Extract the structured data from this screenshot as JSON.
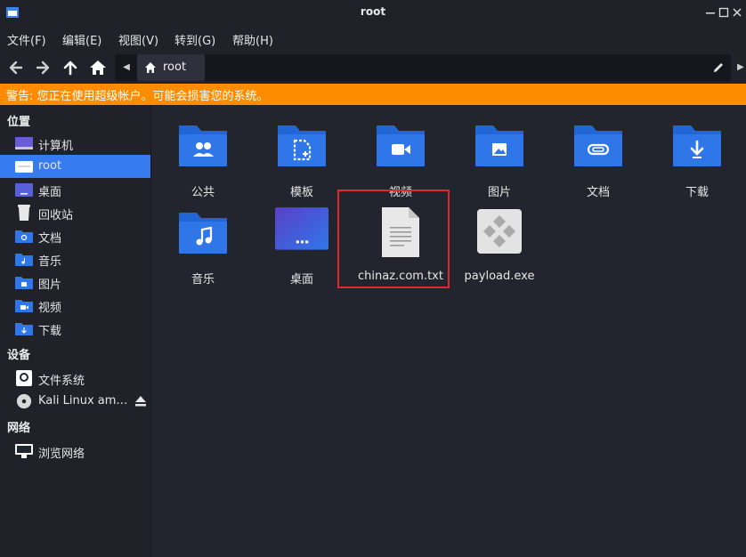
{
  "window": {
    "title": "root"
  },
  "menu": [
    "文件(F)",
    "编辑(E)",
    "视图(V)",
    "转到(G)",
    "帮助(H)"
  ],
  "pathbar": {
    "current": "root"
  },
  "warning": "警告: 您正在使用超级帐户。可能会损害您的系统。",
  "sidebar": {
    "places_heading": "位置",
    "places": [
      {
        "label": "计算机",
        "icon": "computer-icon"
      },
      {
        "label": "root",
        "icon": "home-folder-icon",
        "active": true
      },
      {
        "label": "桌面",
        "icon": "desktop-icon"
      },
      {
        "label": "回收站",
        "icon": "trash-icon"
      },
      {
        "label": "文档",
        "icon": "documents-folder-icon"
      },
      {
        "label": "音乐",
        "icon": "music-folder-icon"
      },
      {
        "label": "图片",
        "icon": "pictures-folder-icon"
      },
      {
        "label": "视频",
        "icon": "videos-folder-icon"
      },
      {
        "label": "下载",
        "icon": "downloads-folder-icon"
      }
    ],
    "devices_heading": "设备",
    "devices": [
      {
        "label": "文件系统",
        "icon": "drive-icon"
      },
      {
        "label": "Kali Linux am…",
        "icon": "disc-icon"
      }
    ],
    "network_heading": "网络",
    "network": [
      {
        "label": "浏览网络",
        "icon": "network-icon"
      }
    ]
  },
  "files": [
    {
      "name": "公共",
      "icon": "public-folder-icon"
    },
    {
      "name": "模板",
      "icon": "templates-folder-icon"
    },
    {
      "name": "视频",
      "icon": "videos-folder-icon"
    },
    {
      "name": "图片",
      "icon": "pictures-folder-icon"
    },
    {
      "name": "文档",
      "icon": "documents-folder-icon"
    },
    {
      "name": "下载",
      "icon": "downloads-folder-icon"
    },
    {
      "name": "音乐",
      "icon": "music-folder-icon"
    },
    {
      "name": "桌面",
      "icon": "desktop-folder-icon"
    },
    {
      "name": "chinaz.com.txt",
      "icon": "text-file-icon",
      "highlighted": true
    },
    {
      "name": "payload.exe",
      "icon": "executable-file-icon"
    }
  ],
  "colors": {
    "accent": "#367bf0",
    "folder_blue": "#2f77e8",
    "warning_bg": "#ff8c00",
    "highlight_border": "#e0282f"
  }
}
